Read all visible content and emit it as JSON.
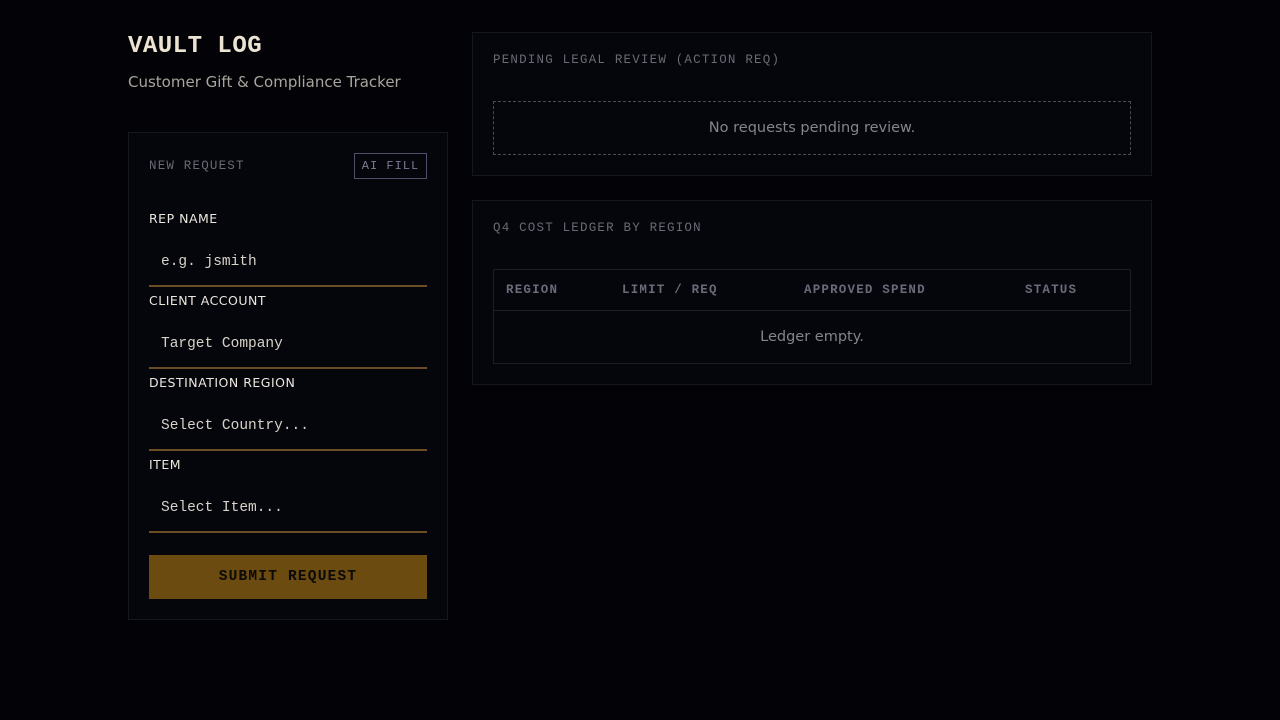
{
  "header": {
    "title": "VAULT LOG",
    "subtitle": "Customer Gift & Compliance Tracker"
  },
  "form": {
    "label": "NEW REQUEST",
    "ai_fill_label": "AI FILL",
    "fields": [
      {
        "label": "REP NAME",
        "placeholder": "e.g. jsmith"
      },
      {
        "label": "CLIENT ACCOUNT",
        "placeholder": "Target Company"
      },
      {
        "label": "DESTINATION REGION",
        "placeholder": "Select Country..."
      },
      {
        "label": "ITEM",
        "placeholder": "Select Item..."
      }
    ],
    "submit_label": "SUBMIT REQUEST"
  },
  "pending": {
    "label": "PENDING LEGAL REVIEW (ACTION REQ)",
    "empty_text": "No requests pending review."
  },
  "ledger": {
    "label": "Q4 COST LEDGER BY REGION",
    "columns": [
      "REGION",
      "LIMIT / REQ",
      "APPROVED SPEND",
      "STATUS"
    ],
    "empty_text": "Ledger empty."
  },
  "colors": {
    "background": "#030307",
    "accent": "#6b4b0f",
    "input_underline": "#6a4d22"
  }
}
